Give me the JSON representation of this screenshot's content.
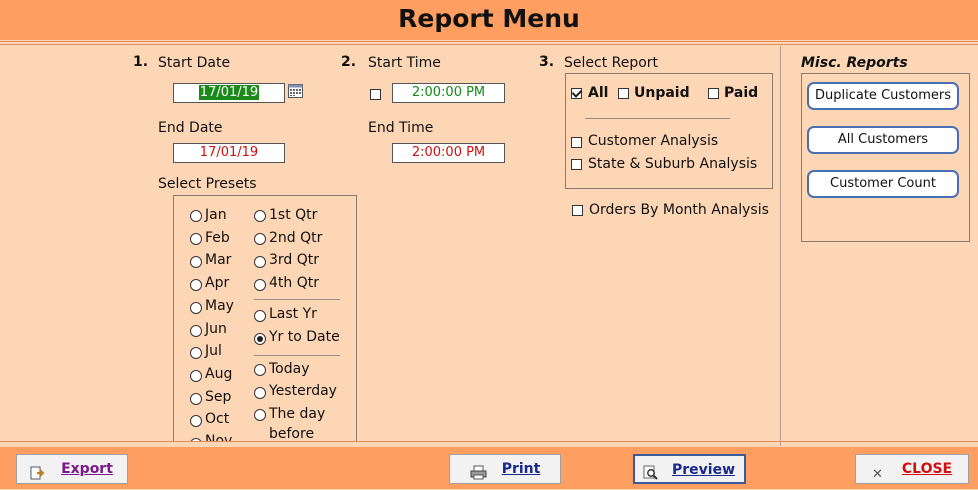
{
  "title": "Report Menu",
  "section1": {
    "number": "1.",
    "start_date_label": "Start Date",
    "start_date_value": "17/01/19",
    "end_date_label": "End Date",
    "end_date_value": "17/01/19",
    "presets_label": "Select Presets",
    "months": [
      "Jan",
      "Feb",
      "Mar",
      "Apr",
      "May",
      "Jun",
      "Jul",
      "Aug",
      "Sep",
      "Oct",
      "Nov"
    ],
    "quarters": [
      "1st Qtr",
      "2nd Qtr",
      "3rd Qtr",
      "4th Qtr"
    ],
    "years": [
      "Last Yr",
      "Yr to Date"
    ],
    "days": [
      "Today",
      "Yesterday",
      "The day",
      "before"
    ],
    "selected_preset": "Yr to Date"
  },
  "section2": {
    "number": "2.",
    "start_time_label": "Start Time",
    "start_time_value": "2:00:00 PM",
    "end_time_label": "End Time",
    "end_time_value": "2:00:00 PM"
  },
  "section3": {
    "number": "3.",
    "label": "Select Report",
    "all_label": "All",
    "unpaid_label": "Unpaid",
    "paid_label": "Paid",
    "customer_analysis_label": "Customer Analysis",
    "state_suburb_label": "State & Suburb Analysis",
    "orders_by_month_label": "Orders By Month Analysis"
  },
  "misc": {
    "label": "Misc. Reports",
    "buttons": [
      "Duplicate Customers",
      "All Customers",
      "Customer Count"
    ]
  },
  "footer": {
    "export_label": "Export",
    "print_label": "Print",
    "preview_label": "Preview",
    "close_label": "CLOSE"
  },
  "colors": {
    "background": "#FDD6B5",
    "title_bar": "#FE9E61",
    "date_text": "#D01010",
    "time_text": "#138A13",
    "selected_field": "#1B8A1B",
    "misc_button_border": "#4A6FB0",
    "export_text": "#7A1A8A",
    "preview_text": "#1A2A8A",
    "close_text": "#D01010"
  }
}
